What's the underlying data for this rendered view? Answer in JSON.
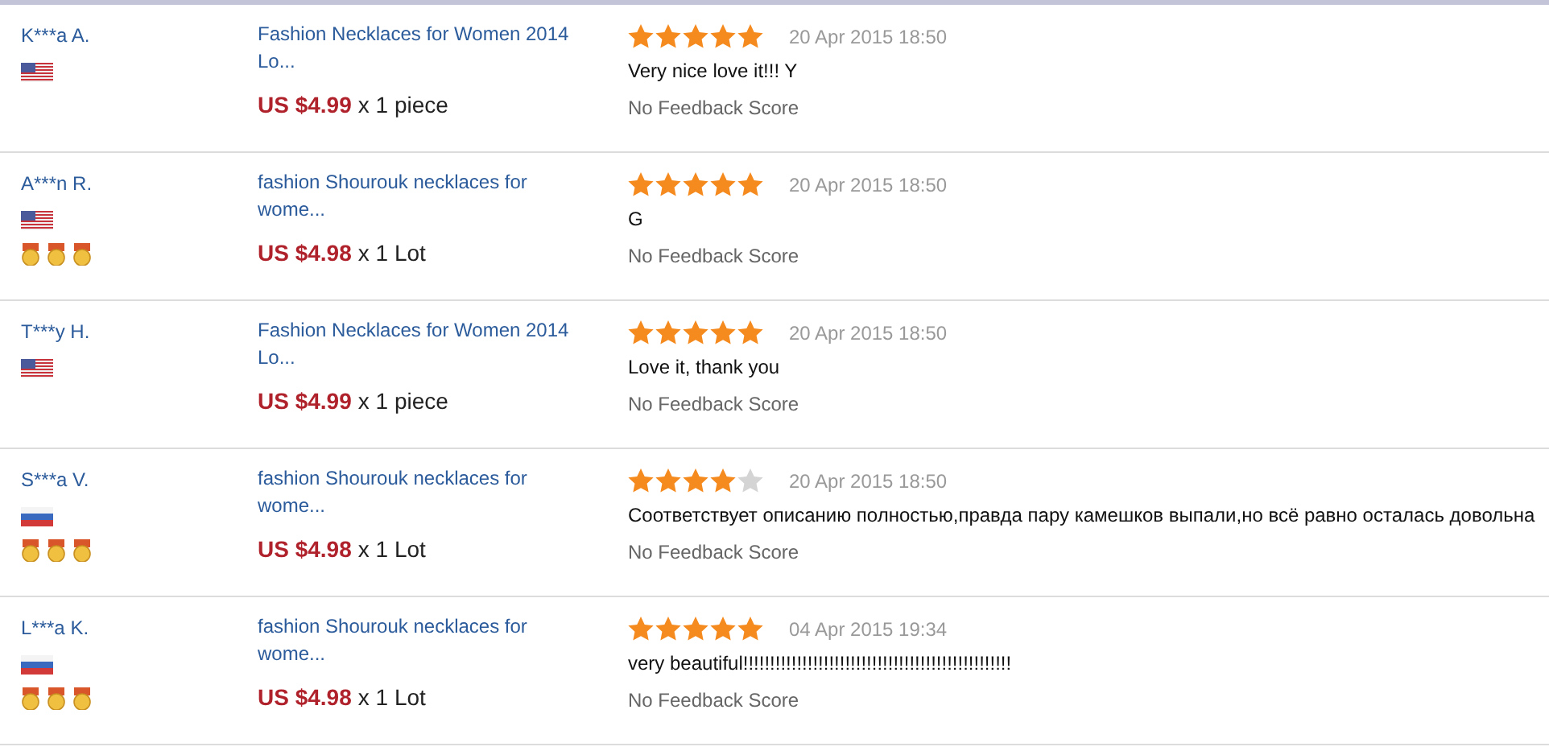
{
  "reviews": [
    {
      "buyer": "K***a A.",
      "flag": {
        "kind": "us"
      },
      "product": "Fashion Necklaces for Women 2014 Lo...",
      "price": "US $4.99",
      "quantity": "x 1 piece",
      "stars": 5,
      "date": "20 Apr 2015 18:50",
      "comment": "Very nice love it!!! Y",
      "feedback": "No Feedback Score"
    },
    {
      "buyer": "A***n R.",
      "flag": {
        "kind": "us"
      },
      "medals": [
        {
          "kind": "gold"
        },
        {
          "kind": "gold"
        },
        {
          "kind": "gold"
        }
      ],
      "product": "fashion Shourouk necklaces for wome...",
      "price": "US $4.98",
      "quantity": "x 1 Lot",
      "stars": 5,
      "date": "20 Apr 2015 18:50",
      "comment": "G",
      "feedback": "No Feedback Score"
    },
    {
      "buyer": "T***y H.",
      "flag": {
        "kind": "us"
      },
      "product": "Fashion Necklaces for Women 2014 Lo...",
      "price": "US $4.99",
      "quantity": "x 1 piece",
      "stars": 5,
      "date": "20 Apr 2015 18:50",
      "comment": "Love it, thank you",
      "feedback": "No Feedback Score"
    },
    {
      "buyer": "S***a V.",
      "flag": {
        "kind": "ru"
      },
      "medals": [
        {
          "kind": "gold"
        },
        {
          "kind": "gold"
        },
        {
          "kind": "gold"
        }
      ],
      "product": "fashion Shourouk necklaces for wome...",
      "price": "US $4.98",
      "quantity": "x 1 Lot",
      "stars": 4,
      "date": "20 Apr 2015 18:50",
      "comment": "Соответствует описанию полностью,правда пару камешков выпали,но всё равно осталась довольна",
      "feedback": "No Feedback Score"
    },
    {
      "buyer": "L***a K.",
      "flag": {
        "kind": "ru"
      },
      "medals": [
        {
          "kind": "gold"
        },
        {
          "kind": "gold"
        },
        {
          "kind": "gold"
        }
      ],
      "product": "fashion Shourouk necklaces for wome...",
      "price": "US $4.98",
      "quantity": "x 1 Lot",
      "stars": 5,
      "date": "04 Apr 2015 19:34",
      "comment": "very beautiful!!!!!!!!!!!!!!!!!!!!!!!!!!!!!!!!!!!!!!!!!!!!!!!!!!",
      "feedback": "No Feedback Score"
    }
  ]
}
